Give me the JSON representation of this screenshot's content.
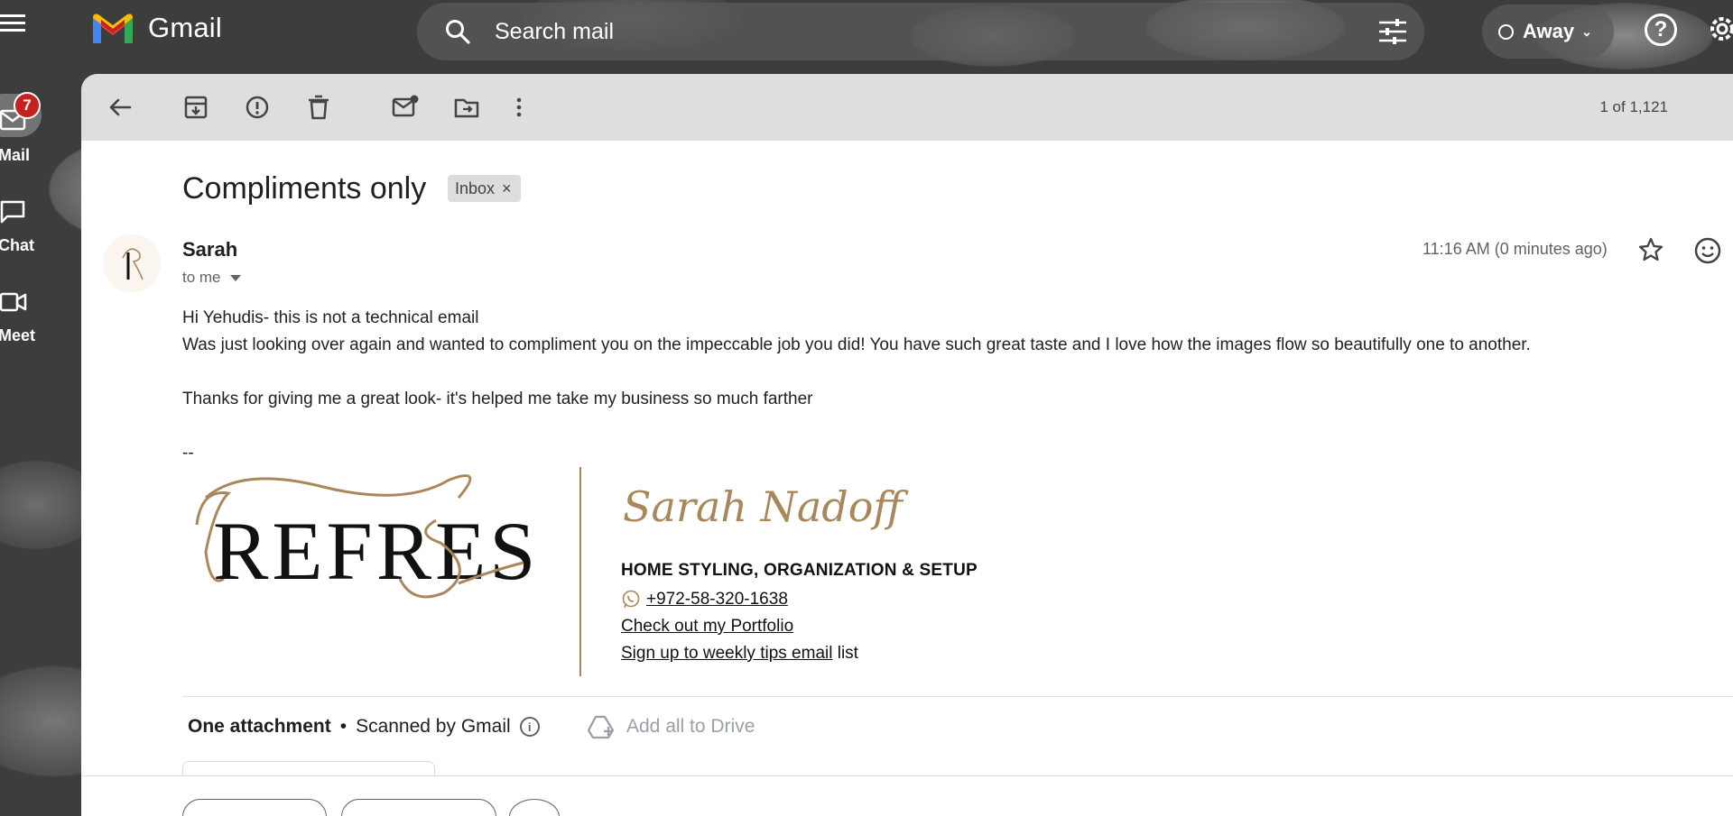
{
  "app": {
    "name": "Gmail"
  },
  "search": {
    "placeholder": "Search mail"
  },
  "status": {
    "label": "Away"
  },
  "rail": {
    "items": [
      {
        "label": "Mail",
        "badge": "7"
      },
      {
        "label": "Chat"
      },
      {
        "label": "Meet"
      }
    ]
  },
  "toolbar": {
    "counter": "1 of 1,121"
  },
  "email": {
    "subject": "Compliments only",
    "label": "Inbox",
    "sender": "Sarah",
    "recipient": "to me",
    "time": "11:16 AM (0 minutes ago)",
    "body": [
      "Hi Yehudis- this is not a technical email",
      "Was just looking over again and wanted to compliment you on the impeccable job you did! You have such great taste and I love how the images flow so beautifully one to another.",
      "",
      "Thanks for giving me a great look- it's helped me take my business so much farther"
    ],
    "separator": "--"
  },
  "signature": {
    "logo_text": "REFRESH",
    "script_name": "Sarah Nadoff",
    "tagline": "HOME STYLING, ORGANIZATION & SETUP",
    "phone": "+972-58-320-1638",
    "portfolio_prefix": "Check out my ",
    "portfolio_link": "Portfolio",
    "tips_link": "Sign up to weekly tips email",
    "tips_suffix": " list",
    "accent_color": "#a8875a"
  },
  "attachments": {
    "title": "One attachment",
    "bullet": "•",
    "scanned": "Scanned by Gmail",
    "add_all": "Add all to Drive"
  },
  "colors": {
    "badge": "#c5221f",
    "text": "#1f1f1f",
    "muted": "#5f6368"
  }
}
